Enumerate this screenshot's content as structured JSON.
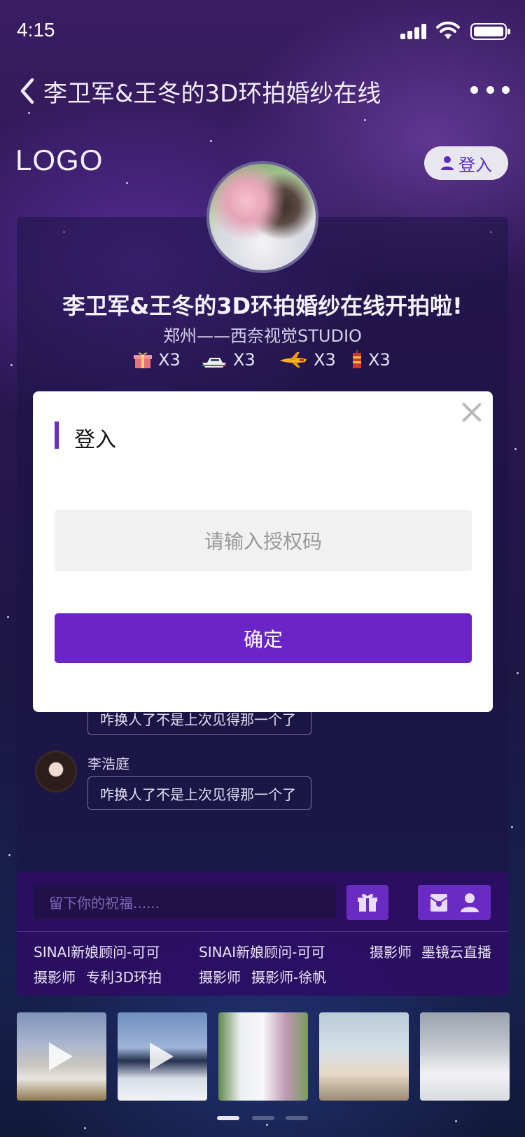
{
  "status_bar": {
    "time": "4:15"
  },
  "nav": {
    "title": "李卫军&王冬的3D环拍婚纱在线"
  },
  "header": {
    "logo": "LOGO",
    "login_label": "登入"
  },
  "event": {
    "title": "李卫军&王冬的3D环拍婚纱在线开拍啦!",
    "subtitle": "郑州——西奈视觉STUDIO",
    "gifts": [
      {
        "icon": "gift-box-icon",
        "count": "X3"
      },
      {
        "icon": "yacht-icon",
        "count": "X3"
      },
      {
        "icon": "airplane-icon",
        "count": "X3"
      },
      {
        "icon": "firecracker-icon",
        "count": "X3"
      }
    ]
  },
  "chat": [
    {
      "name": "",
      "message": "咋换人了不是上次见得那一个了"
    },
    {
      "name": "李浩庭",
      "message": "咋换人了不是上次见得那一个了"
    }
  ],
  "bottom_bar": {
    "wish_placeholder": "留下你的祝福......",
    "buttons": [
      "gift-icon",
      "red-envelope-icon",
      "user-icon"
    ],
    "tags": [
      "SINAI新娘顾问-可可",
      "SINAI新娘顾问-可可",
      "摄影师",
      "墨镜云直播",
      "摄影师",
      "专利3D环拍",
      "摄影师",
      "摄影师-徐帆"
    ]
  },
  "thumbnails": [
    {
      "type": "video",
      "colors": [
        "#7f93b7",
        "#c9c6c0",
        "#4c5f86"
      ]
    },
    {
      "type": "video",
      "colors": [
        "#6f8fc1",
        "#d7dce6",
        "#23304f"
      ]
    },
    {
      "type": "photo",
      "colors": [
        "#5f8a4c",
        "#eef0f2",
        "#c09bb4"
      ]
    },
    {
      "type": "photo",
      "colors": [
        "#b7cad6",
        "#e8d8c6",
        "#7b8f6f"
      ]
    },
    {
      "type": "photo",
      "colors": [
        "#d9dbe0",
        "#9ba2ad",
        "#f2f2f4"
      ]
    }
  ],
  "modal": {
    "title": "登入",
    "input_placeholder": "请输入授权码",
    "confirm_label": "确定"
  },
  "colors": {
    "accent": "#6a24c8",
    "login_text": "#5a2bbf"
  }
}
